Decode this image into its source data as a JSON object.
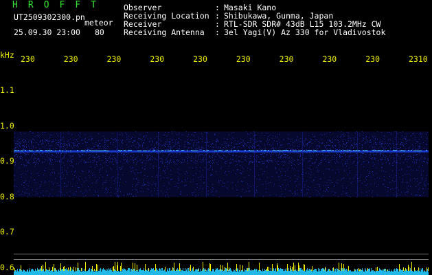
{
  "header": {
    "brand": "H R O F F T",
    "filename": "UT2509302300.pn",
    "mode": "meteor",
    "datetime": "25.09.30 23:00",
    "count": "80",
    "info": [
      {
        "label": "Observer",
        "sep": ":",
        "value": "Masaki Kano"
      },
      {
        "label": "Receiving Location",
        "sep": ":",
        "value": "Shibukawa, Gunma, Japan"
      },
      {
        "label": "Receiver",
        "sep": ":",
        "value": "RTL-SDR SDR# 43dB L15 103.2MHz CW"
      },
      {
        "label": "Receiving Antenna",
        "sep": ":",
        "value": "3el Yagi(V) Az 330 for Vladivostok"
      }
    ]
  },
  "chart_data": {
    "type": "heatmap",
    "ylabel": "kHz",
    "y_ticks": [
      "1.1",
      "1.0",
      "0.9",
      "0.8",
      "0.7",
      "0.6"
    ],
    "y_tick_values": [
      1.1,
      1.0,
      0.9,
      0.8,
      0.7,
      0.6
    ],
    "x_ticks": [
      "230",
      "230",
      "230",
      "230",
      "230",
      "230",
      "230",
      "230",
      "230",
      "2310"
    ],
    "ylim": [
      0.58,
      1.17
    ],
    "signal_band_khz": [
      0.8,
      0.985
    ],
    "carrier_line_khz": 0.93,
    "colors": {
      "background": "#000000",
      "noise": "#1a2a9a",
      "carrier": "#50c8ff",
      "grid": "#7a7a7a",
      "tick_text": "#f0f000",
      "meter_fill": "#22b8e8",
      "meter_peaks": "#f0f000"
    }
  }
}
